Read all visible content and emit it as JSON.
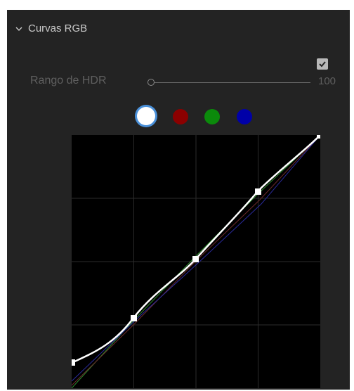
{
  "panel": {
    "title": "Curvas RGB",
    "hdr_label": "Rango de HDR",
    "hdr_value": "100",
    "hdr_checked": true
  },
  "channels": [
    {
      "name": "white-channel",
      "color": "#ffffff",
      "selected": true
    },
    {
      "name": "red-channel",
      "color": "#8b0000",
      "selected": false
    },
    {
      "name": "green-channel",
      "color": "#0b8a0b",
      "selected": false
    },
    {
      "name": "blue-channel",
      "color": "#0000a8",
      "selected": false
    }
  ],
  "icons": {
    "collapse": "chevron-down-icon",
    "check": "checkmark-icon"
  }
}
